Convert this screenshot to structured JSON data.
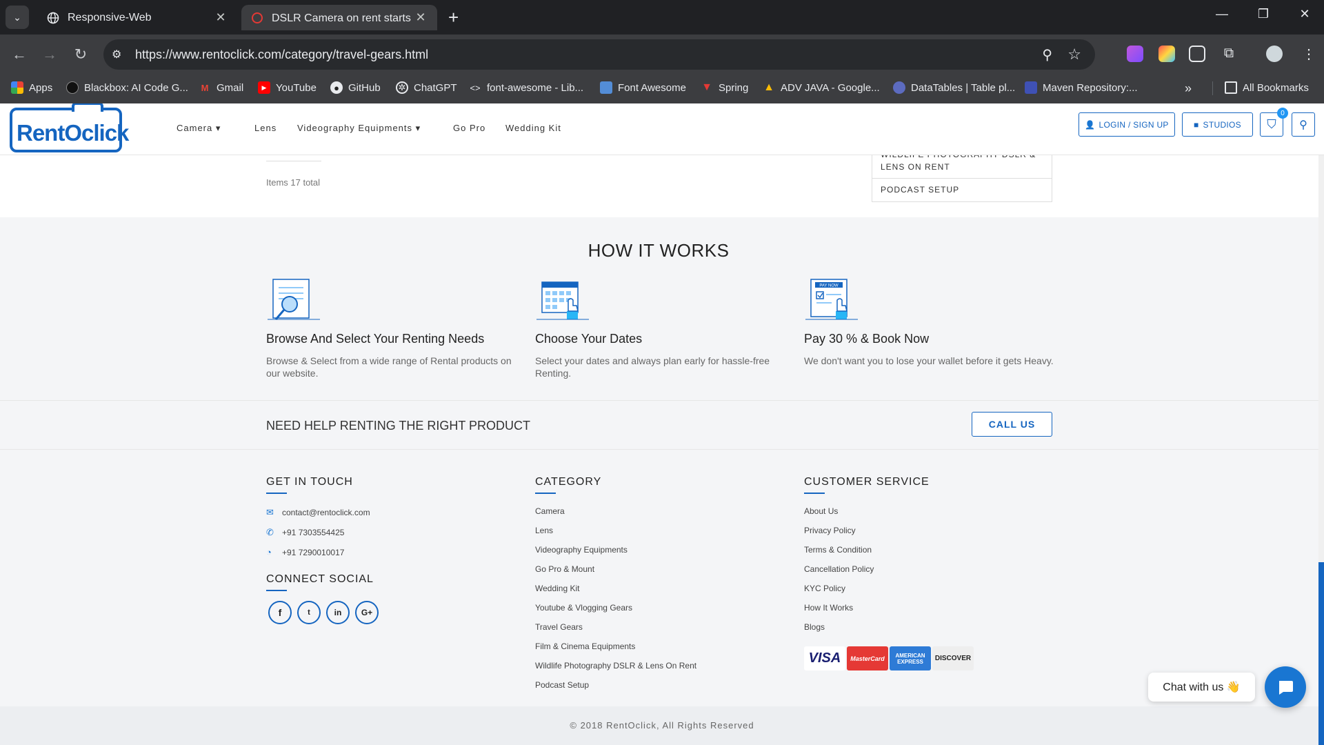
{
  "browser": {
    "tabs": [
      {
        "title": "Responsive-Web",
        "active": false
      },
      {
        "title": "DSLR Camera on rent starts @ ₹",
        "active": true
      }
    ],
    "url": "https://www.rentoclick.com/category/travel-gears.html",
    "bookmarks": [
      "Apps",
      "Blackbox: AI Code G...",
      "Gmail",
      "YouTube",
      "GitHub",
      "ChatGPT",
      "font-awesome - Lib...",
      "Font Awesome",
      "Spring",
      "ADV JAVA - Google...",
      "DataTables | Table pl...",
      "Maven Repository:..."
    ],
    "all_bookmarks": "All Bookmarks"
  },
  "header": {
    "logo": "RentOclick",
    "menu": [
      "Camera",
      "Lens",
      "Videography Equipments",
      "Go Pro",
      "Wedding Kit"
    ],
    "login": "LOGIN / SIGN UP",
    "studios": "STUDIOS",
    "cart_count": "0"
  },
  "listing": {
    "items_total": "Items 17 total",
    "side_categories": [
      "WILDLIFE PHOTOGRAPHY DSLR & LENS ON RENT",
      "PODCAST SETUP"
    ]
  },
  "how_it_works": {
    "title": "HOW IT WORKS",
    "steps": [
      {
        "title": "Browse And Select Your Renting Needs",
        "text": "Browse & Select from a wide range of Rental products on our website."
      },
      {
        "title": "Choose Your Dates",
        "text": "Select your dates and always plan early for hassle-free Renting."
      },
      {
        "title": "Pay 30 % & Book Now",
        "text": "We don't want you to lose your wallet before it gets Heavy.",
        "badge": "PAY NOW"
      }
    ]
  },
  "help": {
    "text": "NEED HELP RENTING THE RIGHT PRODUCT",
    "button": "CALL US"
  },
  "footer": {
    "get_in_touch": "GET IN TOUCH",
    "email": "contact@rentoclick.com",
    "phone": "+91 7303554425",
    "whatsapp": "+91 7290010017",
    "connect_social": "CONNECT SOCIAL",
    "socials": [
      "f",
      "t",
      "in",
      "G+"
    ],
    "category_title": "CATEGORY",
    "categories": [
      "Camera",
      "Lens",
      "Videography Equipments",
      "Go Pro & Mount",
      "Wedding Kit",
      "Youtube & Vlogging Gears",
      "Travel Gears",
      "Film & Cinema Equipments",
      "Wildlife Photography DSLR & Lens On Rent",
      "Podcast Setup"
    ],
    "service_title": "CUSTOMER SERVICE",
    "services": [
      "About Us",
      "Privacy Policy",
      "Terms & Condition",
      "Cancellation Policy",
      "KYC Policy",
      "How It Works",
      "Blogs"
    ],
    "payment_cards": [
      "VISA",
      "MasterCard",
      "AMERICAN EXPRESS",
      "DISCOVER"
    ],
    "copyright": "© 2018 RentOclick, All Rights Reserved"
  },
  "chat": {
    "label": "Chat with us 👋"
  },
  "colors": {
    "brand": "#1565c0",
    "chrome_dark": "#202124",
    "chrome_toolbar": "#3c3d40"
  }
}
